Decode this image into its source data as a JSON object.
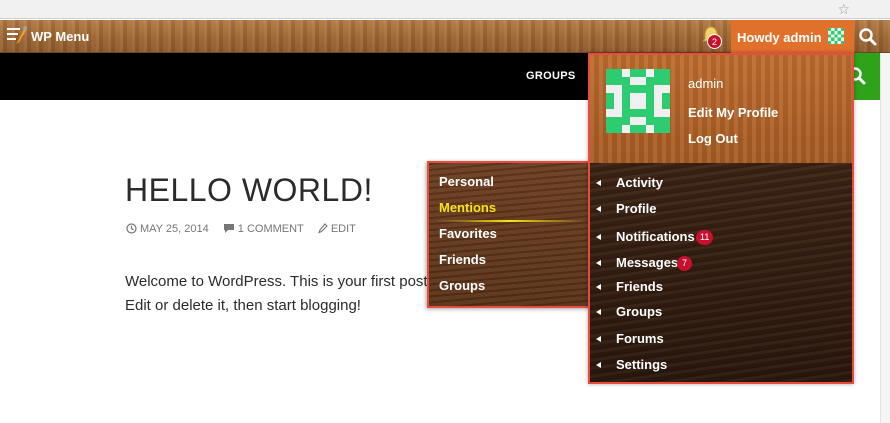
{
  "adminbar": {
    "title": "WP Menu",
    "notification_count": "2",
    "howdy_label": "Howdy admin",
    "colors": {
      "wood": "#a06a36",
      "accent": "#e0702a",
      "badge": "#c8102e"
    }
  },
  "nav": {
    "items": [
      {
        "label": "GROUPS"
      }
    ],
    "search_color": "#2ea31a"
  },
  "post": {
    "title": "HELLO WORLD!",
    "date": "MAY 25, 2014",
    "comments": "1 COMMENT",
    "edit": "EDIT",
    "body": "Welcome to WordPress. This is your first post. Edit or delete it, then start blogging!"
  },
  "account": {
    "name": "admin",
    "edit_profile": "Edit My Profile",
    "logout": "Log Out",
    "items": [
      {
        "label": "Activity"
      },
      {
        "label": "Profile"
      },
      {
        "label": "Notifications",
        "count": "11"
      },
      {
        "label": "Messages",
        "count": "7"
      },
      {
        "label": "Friends"
      },
      {
        "label": "Groups"
      },
      {
        "label": "Forums"
      },
      {
        "label": "Settings"
      }
    ]
  },
  "activity_submenu": {
    "items": [
      {
        "label": "Personal"
      },
      {
        "label": "Mentions",
        "active": true
      },
      {
        "label": "Favorites"
      },
      {
        "label": "Friends"
      },
      {
        "label": "Groups"
      }
    ]
  },
  "icons": {
    "menu_logo": "wp-menu-logo-icon",
    "notification": "bell-icon",
    "search": "search-icon",
    "clock": "clock-icon",
    "comment": "comment-icon",
    "pencil": "pencil-icon"
  }
}
